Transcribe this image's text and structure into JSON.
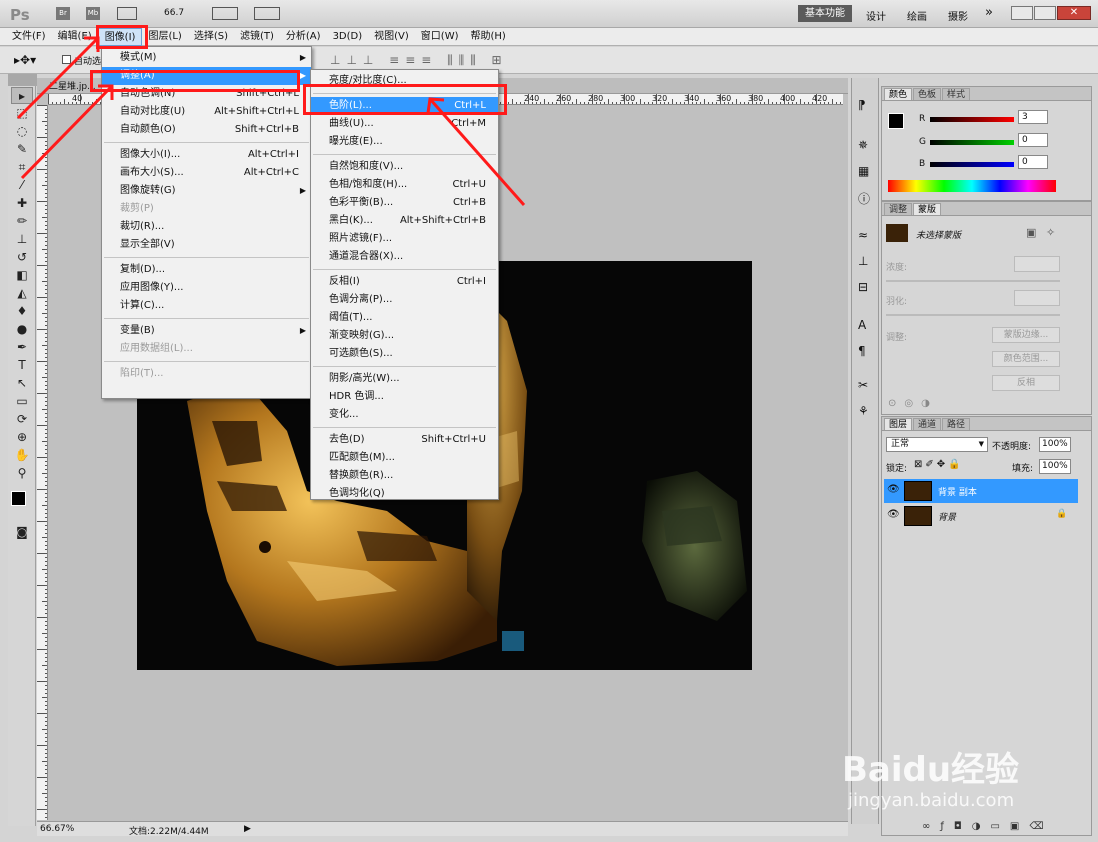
{
  "title_bar": {
    "logo": "Ps",
    "br": "Br",
    "mb": "Mb",
    "zoom": "66.7",
    "workspaces": [
      "基本功能",
      "设计",
      "绘画",
      "摄影"
    ],
    "more": "»"
  },
  "menubar": [
    "文件(F)",
    "编辑(E)",
    "图像(I)",
    "图层(L)",
    "选择(S)",
    "滤镜(T)",
    "分析(A)",
    "3D(D)",
    "视图(V)",
    "窗口(W)",
    "帮助(H)"
  ],
  "options": {
    "auto_select": "自动选"
  },
  "doc_tab": "二星堆.jp...",
  "ruler_labels": [
    "40",
    "240",
    "260",
    "280",
    "300",
    "320",
    "340",
    "360",
    "380",
    "400",
    "420"
  ],
  "image_menu": [
    {
      "label": "模式(M)",
      "shortcut": "",
      "arrow": true
    },
    {
      "label": "调整(A)",
      "shortcut": "",
      "arrow": true,
      "highlight": true
    },
    {
      "label": "自动色调(N)",
      "shortcut": "Shift+Ctrl+L"
    },
    {
      "label": "自动对比度(U)",
      "shortcut": "Alt+Shift+Ctrl+L"
    },
    {
      "label": "自动颜色(O)",
      "shortcut": "Shift+Ctrl+B"
    },
    {
      "sep": true
    },
    {
      "label": "图像大小(I)...",
      "shortcut": "Alt+Ctrl+I"
    },
    {
      "label": "画布大小(S)...",
      "shortcut": "Alt+Ctrl+C"
    },
    {
      "label": "图像旋转(G)",
      "shortcut": "",
      "arrow": true
    },
    {
      "label": "裁剪(P)",
      "shortcut": "",
      "disabled": true
    },
    {
      "label": "裁切(R)...",
      "shortcut": ""
    },
    {
      "label": "显示全部(V)",
      "shortcut": ""
    },
    {
      "sep": true
    },
    {
      "label": "复制(D)...",
      "shortcut": ""
    },
    {
      "label": "应用图像(Y)...",
      "shortcut": ""
    },
    {
      "label": "计算(C)...",
      "shortcut": ""
    },
    {
      "sep": true
    },
    {
      "label": "变量(B)",
      "shortcut": "",
      "arrow": true
    },
    {
      "label": "应用数据组(L)...",
      "shortcut": "",
      "disabled": true
    },
    {
      "sep": true
    },
    {
      "label": "陷印(T)...",
      "shortcut": "",
      "disabled": true
    }
  ],
  "adjust_menu": [
    {
      "label": "亮度/对比度(C)...",
      "shortcut": ""
    },
    {
      "sep": true
    },
    {
      "label": "色阶(L)...",
      "shortcut": "Ctrl+L",
      "highlight": true
    },
    {
      "label": "曲线(U)...",
      "shortcut": "Ctrl+M"
    },
    {
      "label": "曝光度(E)...",
      "shortcut": ""
    },
    {
      "sep": true
    },
    {
      "label": "自然饱和度(V)...",
      "shortcut": ""
    },
    {
      "label": "色相/饱和度(H)...",
      "shortcut": "Ctrl+U"
    },
    {
      "label": "色彩平衡(B)...",
      "shortcut": "Ctrl+B"
    },
    {
      "label": "黑白(K)...",
      "shortcut": "Alt+Shift+Ctrl+B"
    },
    {
      "label": "照片滤镜(F)...",
      "shortcut": ""
    },
    {
      "label": "通道混合器(X)...",
      "shortcut": ""
    },
    {
      "sep": true
    },
    {
      "label": "反相(I)",
      "shortcut": "Ctrl+I"
    },
    {
      "label": "色调分离(P)...",
      "shortcut": ""
    },
    {
      "label": "阈值(T)...",
      "shortcut": ""
    },
    {
      "label": "渐变映射(G)...",
      "shortcut": ""
    },
    {
      "label": "可选颜色(S)...",
      "shortcut": ""
    },
    {
      "sep": true
    },
    {
      "label": "阴影/高光(W)...",
      "shortcut": ""
    },
    {
      "label": "HDR 色调...",
      "shortcut": ""
    },
    {
      "label": "变化...",
      "shortcut": ""
    },
    {
      "sep": true
    },
    {
      "label": "去色(D)",
      "shortcut": "Shift+Ctrl+U"
    },
    {
      "label": "匹配颜色(M)...",
      "shortcut": ""
    },
    {
      "label": "替换颜色(R)...",
      "shortcut": ""
    },
    {
      "label": "色调均化(Q)",
      "shortcut": ""
    }
  ],
  "color_panel": {
    "tabs": [
      "颜色",
      "色板",
      "样式"
    ],
    "r_label": "R",
    "g_label": "G",
    "b_label": "B",
    "r": "3",
    "g": "0",
    "b": "0"
  },
  "mask_panel": {
    "tabs": [
      "调整",
      "蒙版"
    ],
    "no_mask": "未选择蒙版",
    "density": "浓度:",
    "feather": "羽化:",
    "refine": "调整:",
    "mask_edge": "蒙版边缘...",
    "color_range": "颜色范围...",
    "invert": "反相"
  },
  "layers_panel": {
    "tabs": [
      "图层",
      "通道",
      "路径"
    ],
    "blend_mode": "正常",
    "opacity_label": "不透明度:",
    "opacity": "100%",
    "lock_label": "锁定:",
    "fill_label": "填充:",
    "fill": "100%",
    "layers": [
      {
        "name": "背景 副本",
        "selected": true
      },
      {
        "name": "背景",
        "selected": false
      }
    ]
  },
  "status": {
    "zoom": "66.67%",
    "doc": "文档:2.22M/4.44M"
  },
  "watermark": {
    "brand": "Baidu经验",
    "url": "jingyan.baidu.com"
  },
  "colors": {
    "highlight": "#3399ff",
    "annotation": "#ff1a1a",
    "workspace_active": "#5b5b5b"
  }
}
